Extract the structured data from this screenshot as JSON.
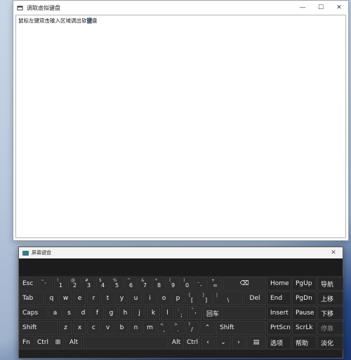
{
  "app": {
    "title": "调取虚拟键盘",
    "minimize": "—",
    "maximize": "☐",
    "close": "✕",
    "text_before": "鼠标左键双击输入区域调出软",
    "text_selected": "键",
    "text_after": "盘"
  },
  "osk": {
    "title": "屏幕键盘",
    "close": "✕",
    "keys": {
      "esc": "Esc",
      "backtick_top": "~",
      "backtick": "`",
      "1_top": "!",
      "1": "1",
      "2_top": "@",
      "2": "2",
      "3_top": "#",
      "3": "3",
      "4_top": "$",
      "4": "4",
      "5_top": "%",
      "5": "5",
      "6_top": "^",
      "6": "6",
      "7_top": "&",
      "7": "7",
      "8_top": "*",
      "8": "8",
      "9_top": "(",
      "9": "9",
      "0_top": ")",
      "0": "0",
      "minus_top": "_",
      "minus": "-",
      "equal_top": "+",
      "equal": "=",
      "backspace": "⌫",
      "home": "Home",
      "pgup": "PgUp",
      "nav": "导航",
      "tab": "Tab",
      "q": "q",
      "w": "w",
      "e": "e",
      "r": "r",
      "t": "t",
      "y": "y",
      "u": "u",
      "i": "i",
      "o": "o",
      "p": "p",
      "lbracket_top": "{",
      "lbracket": "[",
      "rbracket_top": "}",
      "rbracket": "]",
      "backslash_top": "|",
      "backslash": "\\",
      "del": "Del",
      "end": "End",
      "pgdn": "PgDn",
      "up_move": "上移",
      "caps": "Caps",
      "a": "a",
      "s": "s",
      "d": "d",
      "f": "f",
      "g": "g",
      "h": "h",
      "j": "j",
      "k": "k",
      "l": "l",
      "semicolon_top": ":",
      "semicolon": ";",
      "quote_top": "\"",
      "quote": "'",
      "enter": "回车",
      "insert": "Insert",
      "pause": "Pause",
      "down_move": "下移",
      "shift": "Shift",
      "z": "z",
      "x": "x",
      "c": "c",
      "v": "v",
      "b": "b",
      "n": "n",
      "m": "m",
      "comma_top": "<",
      "comma": ",",
      "period_top": ">",
      "period": ".",
      "slash_top": "?",
      "slash": "/",
      "up": "⌃",
      "shift_right": "Shift",
      "prtscn": "PrtScn",
      "scrlk": "ScrLk",
      "dock": "停靠",
      "fn": "Fn",
      "ctrl": "Ctrl",
      "win": "⊞",
      "alt": "Alt",
      "space": "",
      "alt_right": "Alt",
      "ctrl_right": "Ctrl",
      "left": "‹",
      "down": "⌄",
      "right": "›",
      "menu": "▤",
      "options": "选项",
      "help": "帮助",
      "fade": "淡化"
    }
  }
}
